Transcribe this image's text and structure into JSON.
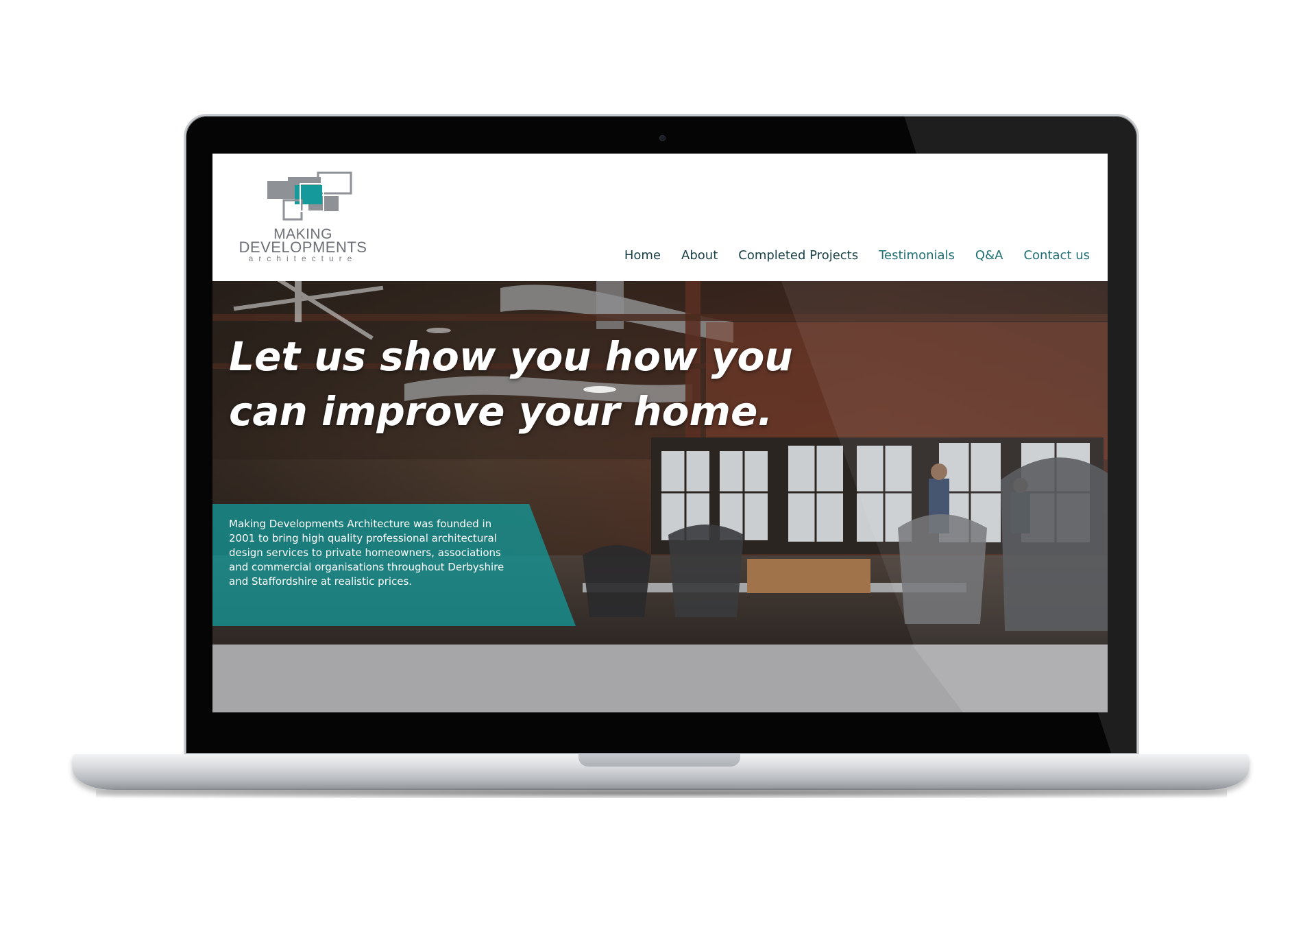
{
  "site": {
    "logo": {
      "line1": "MAKING",
      "line2": "DEVELOPMENTS",
      "line3": "architecture"
    },
    "nav": [
      {
        "label": "Home"
      },
      {
        "label": "About"
      },
      {
        "label": "Completed Projects"
      },
      {
        "label": "Testimonials"
      },
      {
        "label": "Q&A"
      },
      {
        "label": "Contact us"
      }
    ],
    "hero": {
      "headline": "Let us show you how you can improve your home.",
      "body": "Making Developments Architecture was founded in 2001 to bring high quality professional architectural design services to private homeowners, associations and commercial organisations throughout Derbyshire and Staffordshire at realistic prices."
    }
  },
  "colors": {
    "accent_teal": "#1a9999",
    "nav_text": "#1f6f72",
    "logo_grey": "#6d7075"
  },
  "icons": {
    "logo_mark": "overlapping-rectangles-logo"
  }
}
